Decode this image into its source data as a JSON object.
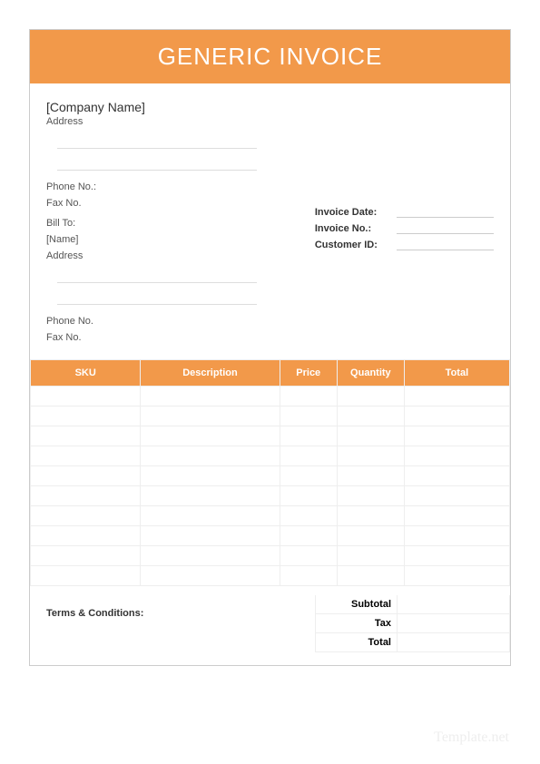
{
  "colors": {
    "accent": "#f2994a"
  },
  "title": "GENERIC INVOICE",
  "company": {
    "name": "[Company Name]",
    "address_label": "Address",
    "phone_label": "Phone No.:",
    "fax_label": "Fax No."
  },
  "invoice_meta": {
    "date_label": "Invoice Date:",
    "number_label": "Invoice No.:",
    "customer_label": "Customer ID:"
  },
  "bill_to": {
    "heading": "Bill To:",
    "name": "[Name]",
    "address_label": "Address",
    "phone_label": "Phone No.",
    "fax_label": "Fax No."
  },
  "table": {
    "headers": {
      "sku": "SKU",
      "description": "Description",
      "price": "Price",
      "quantity": "Quantity",
      "total": "Total"
    },
    "rows": [
      {},
      {},
      {},
      {},
      {},
      {},
      {},
      {},
      {},
      {}
    ]
  },
  "summary": {
    "subtotal_label": "Subtotal",
    "tax_label": "Tax",
    "total_label": "Total"
  },
  "terms_label": "Terms & Conditions:",
  "watermark": "Template.net"
}
